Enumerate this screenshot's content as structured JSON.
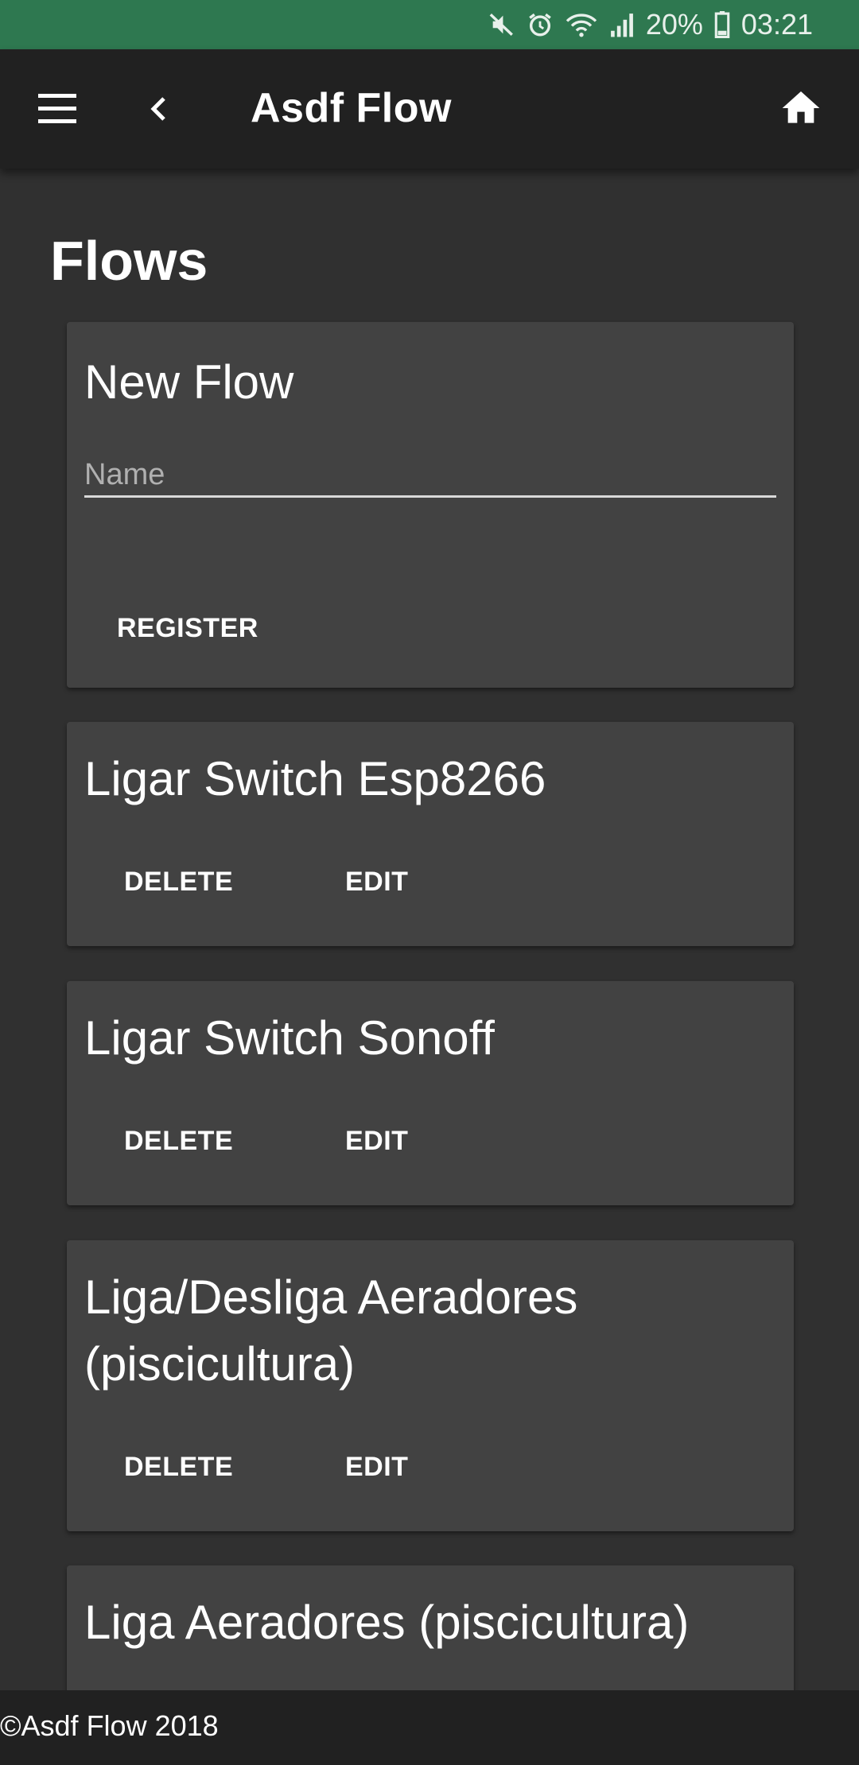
{
  "status_bar": {
    "battery": "20%",
    "time": "03:21",
    "icons": [
      "mute-icon",
      "alarm-icon",
      "wifi-icon",
      "signal-icon",
      "battery-icon"
    ]
  },
  "app_bar": {
    "title": "Asdf Flow",
    "icons": [
      "menu-icon",
      "back-icon",
      "home-icon"
    ]
  },
  "page": {
    "title": "Flows"
  },
  "new_flow": {
    "title": "New Flow",
    "name_placeholder": "Name",
    "name_value": "",
    "register_label": "REGISTER"
  },
  "flows": [
    {
      "name": "Ligar Switch Esp8266",
      "delete_label": "DELETE",
      "edit_label": "EDIT"
    },
    {
      "name": "Ligar Switch Sonoff",
      "delete_label": "DELETE",
      "edit_label": "EDIT"
    },
    {
      "name": "Liga/Desliga Aeradores (piscicultura)",
      "delete_label": "DELETE",
      "edit_label": "EDIT"
    },
    {
      "name": "Liga Aeradores (piscicultura)"
    }
  ],
  "footer": {
    "copyright": "©Asdf Flow 2018"
  },
  "colors": {
    "status_bar": "#2e7850",
    "app_bar": "#212121",
    "background": "#303030",
    "card": "#424242",
    "footer": "#212121"
  }
}
